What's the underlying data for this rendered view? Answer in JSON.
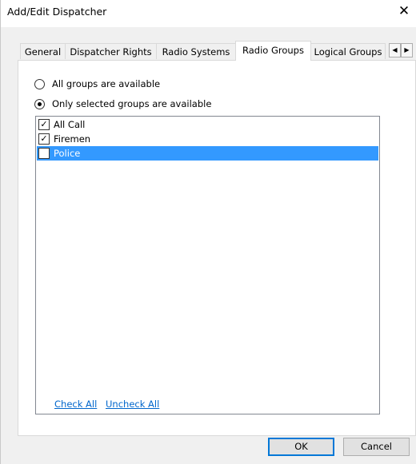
{
  "window": {
    "title": "Add/Edit Dispatcher",
    "close_glyph": "✕"
  },
  "tabs": [
    {
      "label": "General",
      "active": false
    },
    {
      "label": "Dispatcher Rights",
      "active": false
    },
    {
      "label": "Radio Systems",
      "active": false
    },
    {
      "label": "Radio Groups",
      "active": true
    },
    {
      "label": "Logical Groups",
      "active": false
    }
  ],
  "tab_scroll": {
    "left_glyph": "◀",
    "right_glyph": "▶"
  },
  "availability": {
    "options": [
      {
        "label": "All groups are available",
        "selected": false
      },
      {
        "label": "Only selected groups are available",
        "selected": true
      }
    ]
  },
  "groups": [
    {
      "label": "All Call",
      "checked": true,
      "highlighted": false
    },
    {
      "label": "Firemen",
      "checked": true,
      "highlighted": false
    },
    {
      "label": "Police",
      "checked": false,
      "highlighted": true
    }
  ],
  "links": {
    "check_all": "Check All",
    "uncheck_all": "Uncheck All"
  },
  "buttons": {
    "ok": "OK",
    "cancel": "Cancel"
  },
  "colors": {
    "selection": "#3399ff",
    "link": "#0066cc",
    "default_button_border": "#0078d7"
  }
}
